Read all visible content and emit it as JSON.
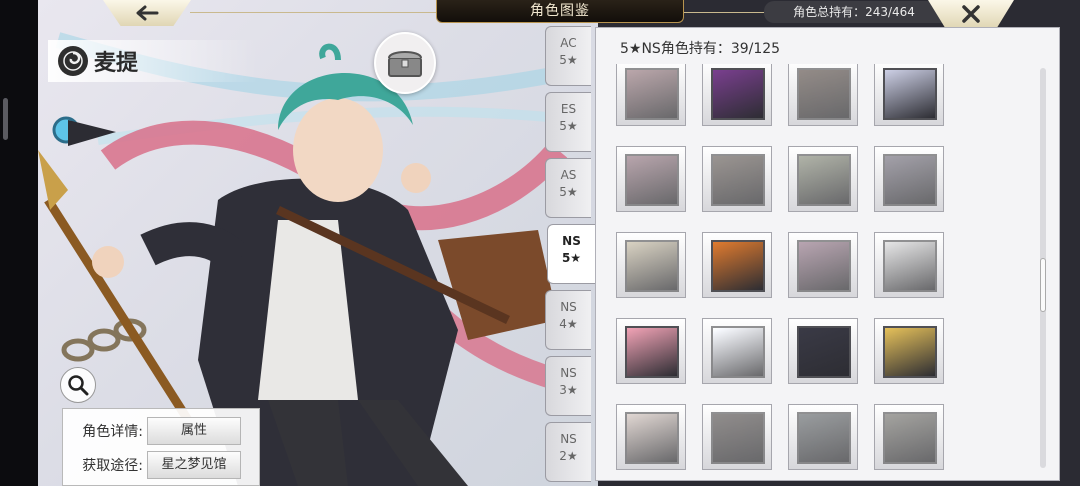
{
  "header": {
    "title": "角色图鉴",
    "owned_total": "角色总持有：243/464"
  },
  "character": {
    "name": "麦提"
  },
  "info": {
    "detail_label": "角色详情:",
    "detail_value": "属性",
    "source_label": "获取途径:",
    "source_value": "星之梦见馆"
  },
  "tabs": [
    {
      "line1": "AC",
      "line2": "5★",
      "active": false
    },
    {
      "line1": "ES",
      "line2": "5★",
      "active": false
    },
    {
      "line1": "AS",
      "line2": "5★",
      "active": false
    },
    {
      "line1": "NS",
      "line2": "5★",
      "active": true
    },
    {
      "line1": "NS",
      "line2": "4★",
      "active": false
    },
    {
      "line1": "NS",
      "line2": "3★",
      "active": false
    },
    {
      "line1": "NS",
      "line2": "2★",
      "active": false
    }
  ],
  "grid": {
    "heading": "5★NS角色持有：39/125",
    "portraits": [
      {
        "owned": false,
        "color": "#b65a6d"
      },
      {
        "owned": true,
        "color": "#7a3f8f"
      },
      {
        "owned": false,
        "color": "#6a4634"
      },
      {
        "owned": true,
        "color": "#cdd0e6"
      },
      {
        "owned": false,
        "color": "#b0587a"
      },
      {
        "owned": false,
        "color": "#6c5242"
      },
      {
        "owned": false,
        "color": "#6f7d49"
      },
      {
        "owned": false,
        "color": "#6a5f86"
      },
      {
        "owned": false,
        "color": "#b99a52"
      },
      {
        "owned": true,
        "color": "#e07b2f"
      },
      {
        "owned": false,
        "color": "#b0568f"
      },
      {
        "owned": false,
        "color": "#b2b2b4"
      },
      {
        "owned": true,
        "color": "#f2a3b6"
      },
      {
        "owned": false,
        "color": "#c9d2e8"
      },
      {
        "owned": true,
        "color": "#3a3a46"
      },
      {
        "owned": true,
        "color": "#e6c15a"
      },
      {
        "owned": false,
        "color": "#c79b87"
      },
      {
        "owned": false,
        "color": "#5a4a46"
      },
      {
        "owned": false,
        "color": "#52606a"
      },
      {
        "owned": false,
        "color": "#6a6656"
      }
    ]
  }
}
